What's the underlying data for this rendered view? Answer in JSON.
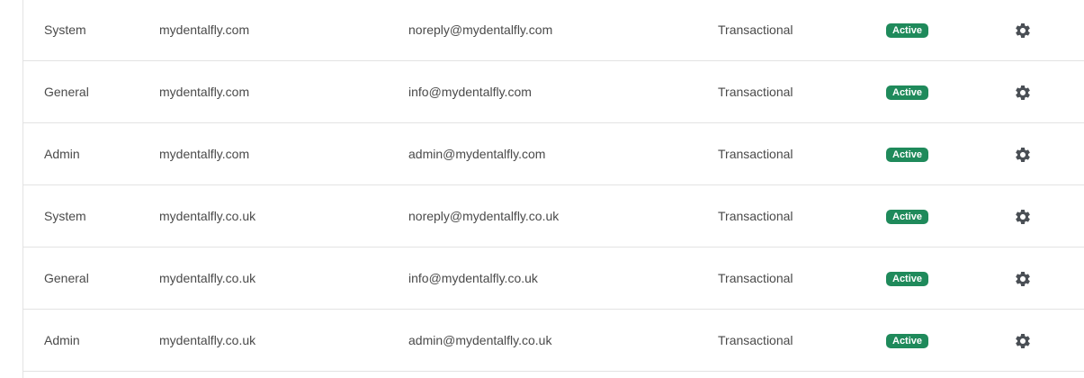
{
  "rows": [
    {
      "type": "System",
      "domain": "mydentalfly.com",
      "email": "noreply@mydentalfly.com",
      "category": "Transactional",
      "status": "Active"
    },
    {
      "type": "General",
      "domain": "mydentalfly.com",
      "email": "info@mydentalfly.com",
      "category": "Transactional",
      "status": "Active"
    },
    {
      "type": "Admin",
      "domain": "mydentalfly.com",
      "email": "admin@mydentalfly.com",
      "category": "Transactional",
      "status": "Active"
    },
    {
      "type": "System",
      "domain": "mydentalfly.co.uk",
      "email": "noreply@mydentalfly.co.uk",
      "category": "Transactional",
      "status": "Active"
    },
    {
      "type": "General",
      "domain": "mydentalfly.co.uk",
      "email": "info@mydentalfly.co.uk",
      "category": "Transactional",
      "status": "Active"
    },
    {
      "type": "Admin",
      "domain": "mydentalfly.co.uk",
      "email": "admin@mydentalfly.co.uk",
      "category": "Transactional",
      "status": "Active"
    }
  ],
  "colors": {
    "status_active": "#1f8a5b",
    "text": "#4a4a4a",
    "gear_icon": "#4a4f55",
    "divider": "#e3e3e3"
  },
  "icons": {
    "row_action": "gear-icon"
  }
}
